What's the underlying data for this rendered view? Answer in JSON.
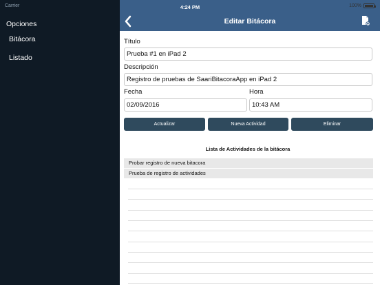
{
  "status": {
    "carrier": "Carrier",
    "time": "4:24 PM",
    "battery": "100%"
  },
  "sidebar": {
    "title": "Opciones",
    "items": [
      {
        "label": "Bitácora"
      },
      {
        "label": "Listado"
      }
    ]
  },
  "navbar": {
    "title": "Editar Bitácora",
    "back_icon": "chevron-left-icon",
    "action_icon": "document-icon"
  },
  "form": {
    "titulo_label": "Título",
    "titulo_value": "Prueba #1 en iPad 2",
    "descripcion_label": "Descripción",
    "descripcion_value": "Registro de pruebas de SaariBitacoraApp en iPad 2",
    "fecha_label": "Fecha",
    "fecha_value": "02/09/2016",
    "hora_label": "Hora",
    "hora_value": "10:43 AM"
  },
  "buttons": {
    "actualizar": "Actualizar",
    "nueva_actividad": "Nueva Actividad",
    "eliminar": "Eliminar"
  },
  "activities": {
    "title": "Lista de Actividades de la bitácora",
    "items": [
      {
        "label": "Probar registro de nueva bitacora"
      },
      {
        "label": "Prueba de registro de actividades"
      }
    ]
  },
  "colors": {
    "navbar": "#3a5f89",
    "sidebar": "#0f1a25",
    "button": "#2f4a5d"
  }
}
